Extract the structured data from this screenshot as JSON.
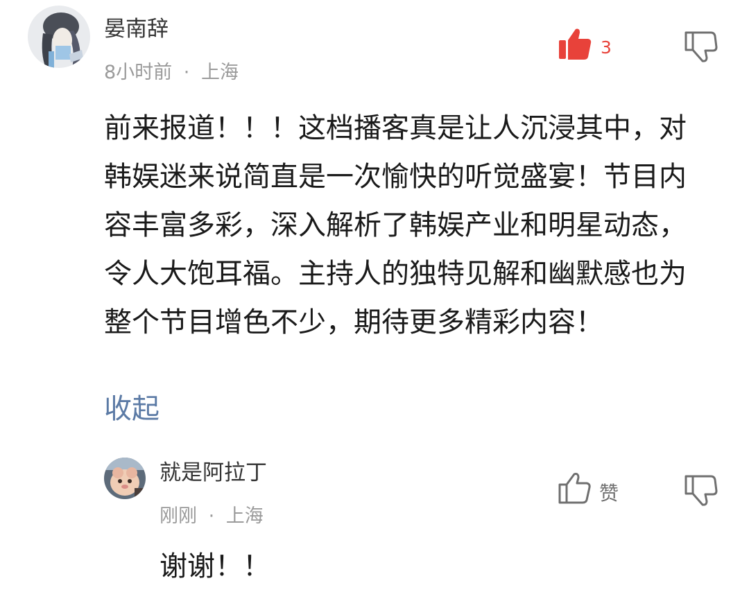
{
  "comment": {
    "username": "晏南辞",
    "time": "8小时前",
    "separator": "·",
    "location": "上海",
    "like_count": "3",
    "body": "前来报道！！！这档播客真是让人沉浸其中，对韩娱迷来说简直是一次愉快的听觉盛宴！节目内容丰富多彩，深入解析了韩娱产业和明星动态，令人大饱耳福。主持人的独特见解和幽默感也为整个节目增色不少，期待更多精彩内容！",
    "collapse_label": "收起",
    "like_icon": "thumbs-up-filled-icon",
    "dislike_icon": "thumbs-down-outline-icon"
  },
  "reply": {
    "username": "就是阿拉丁",
    "time": "刚刚",
    "separator": "·",
    "location": "上海",
    "like_label": "赞",
    "body": "谢谢！！",
    "like_icon": "thumbs-up-outline-icon",
    "dislike_icon": "thumbs-down-outline-icon"
  },
  "colors": {
    "like_active": "#e8423a",
    "icon_gray": "#6f6f6f",
    "meta_gray": "#9a9a9a",
    "link_blue": "#5b7aa5"
  }
}
